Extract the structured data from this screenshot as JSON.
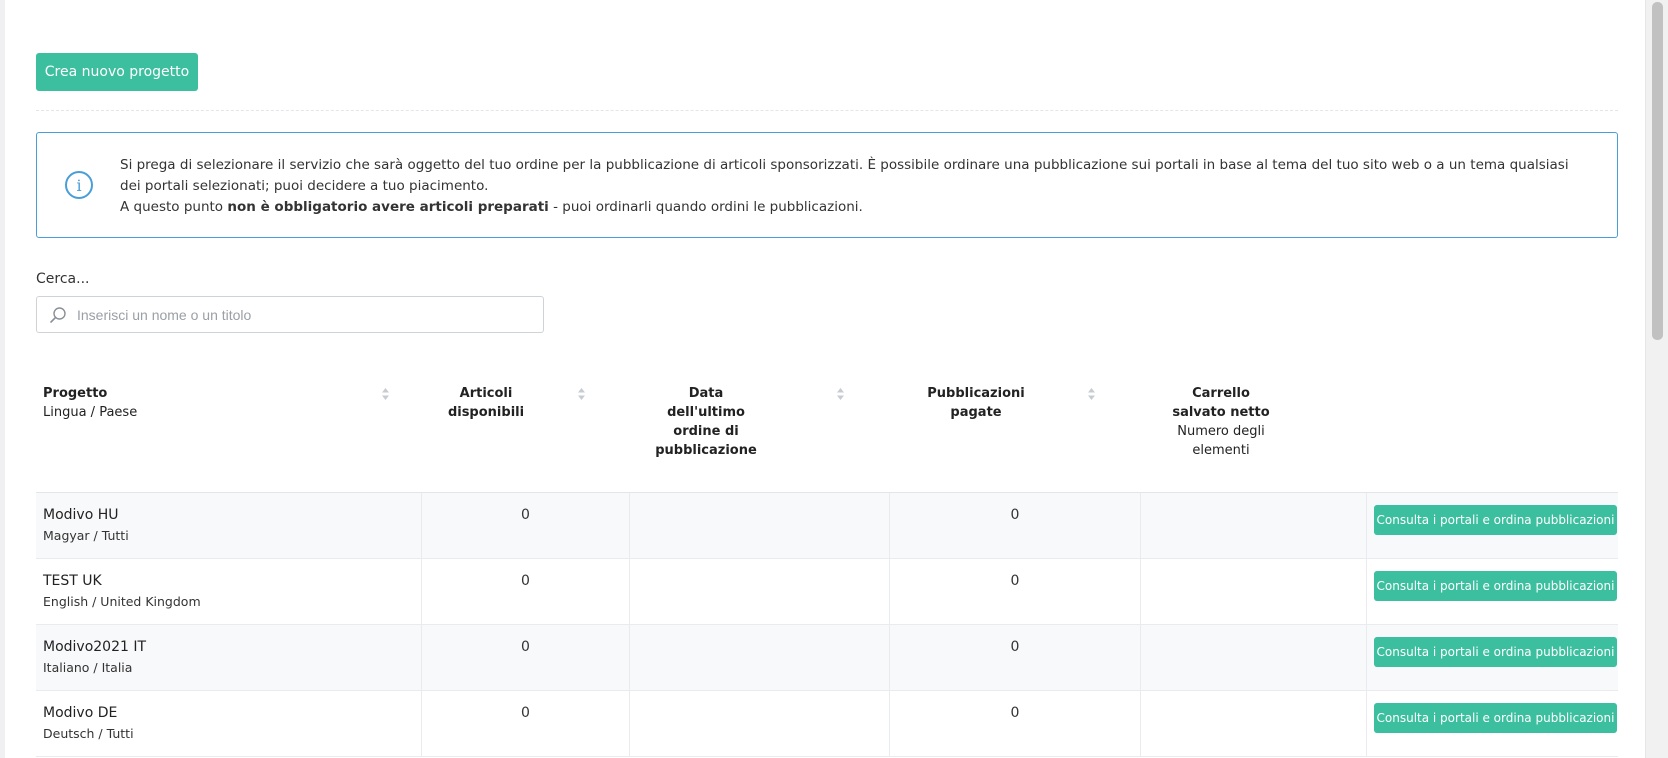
{
  "toolbar": {
    "create_label": "Crea nuovo progetto"
  },
  "info": {
    "line1": "Si prega di selezionare il servizio che sarà oggetto del tuo ordine per la pubblicazione di articoli sponsorizzati. È possibile ordinare una pubblicazione sui portali in base al tema del tuo sito web o a un tema qualsiasi dei portali selezionati; puoi decidere a tuo piacimento.",
    "line2_prefix": "A questo punto ",
    "line2_bold": "non è obbligatorio avere articoli preparati",
    "line2_suffix": " - puoi ordinarli quando ordini le pubblicazioni."
  },
  "search": {
    "label": "Cerca...",
    "placeholder": "Inserisci un nome o un titolo",
    "value": ""
  },
  "table": {
    "headers": {
      "project": {
        "main": "Progetto",
        "sub": "Lingua / Paese"
      },
      "articles": {
        "main1": "Articoli",
        "main2": "disponibili"
      },
      "date": {
        "main1": "Data",
        "main2": "dell'ultimo",
        "main3": "ordine di",
        "main4": "pubblicazione"
      },
      "paid": {
        "main1": "Pubblicazioni",
        "main2": "pagate"
      },
      "cart": {
        "main1": "Carrello",
        "main2": "salvato netto",
        "sub1": "Numero degli",
        "sub2": "elementi"
      }
    },
    "action_label": "Consulta i portali e ordina pubblicazioni",
    "rows": [
      {
        "name": "Modivo HU",
        "lang": "Magyar / Tutti",
        "articles": "0",
        "date": "",
        "paid": "0",
        "cart": ""
      },
      {
        "name": "TEST UK",
        "lang": "English / United Kingdom",
        "articles": "0",
        "date": "",
        "paid": "0",
        "cart": ""
      },
      {
        "name": "Modivo2021 IT",
        "lang": "Italiano / Italia",
        "articles": "0",
        "date": "",
        "paid": "0",
        "cart": ""
      },
      {
        "name": "Modivo DE",
        "lang": "Deutsch / Tutti",
        "articles": "0",
        "date": "",
        "paid": "0",
        "cart": ""
      }
    ]
  },
  "colors": {
    "accent": "#3cbf9e",
    "info_border": "#4a9ed8"
  }
}
